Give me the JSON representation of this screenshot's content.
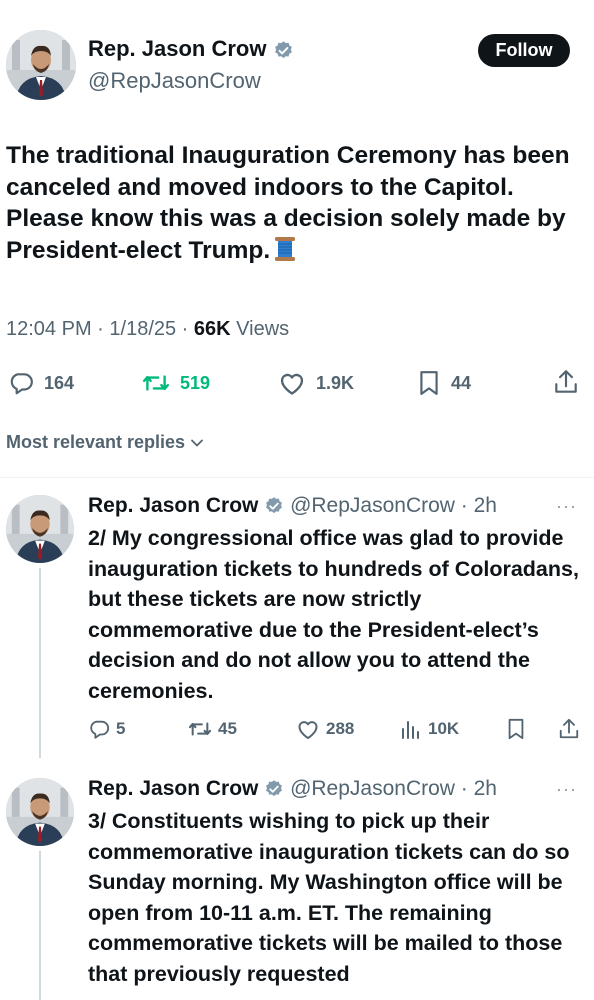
{
  "main_tweet": {
    "author_name": "Rep. Jason Crow",
    "handle": "@RepJasonCrow",
    "follow_label": "Follow",
    "text": "The traditional Inauguration Ceremony has been canceled and moved indoors to the Capitol. Please know this was a decision solely made by President-elect Trump.",
    "emoji_icon": "thread-spool-icon",
    "time": "12:04 PM",
    "date": "1/18/25",
    "views_count": "66K",
    "views_label": "Views",
    "stats": {
      "replies": "164",
      "retweets": "519",
      "likes": "1.9K",
      "bookmarks": "44"
    },
    "retweet_color": "#00ba7c"
  },
  "replies_sort_label": "Most relevant replies",
  "replies": [
    {
      "author_name": "Rep. Jason Crow",
      "handle": "@RepJasonCrow",
      "age": "2h",
      "text": "2/ My congressional office was glad to provide inauguration tickets to hundreds of Coloradans, but these tickets are now strictly commemorative due to the President-elect’s decision and do not allow you to attend the ceremonies.",
      "stats": {
        "replies": "5",
        "retweets": "45",
        "likes": "288",
        "views": "10K"
      }
    },
    {
      "author_name": "Rep. Jason Crow",
      "handle": "@RepJasonCrow",
      "age": "2h",
      "text": "3/ Constituents wishing to pick up their commemorative inauguration tickets can do so Sunday morning. My Washington office will be open from 10-11 a.m. ET. The remaining commemorative tickets will be mailed to those that previously requested"
    }
  ],
  "colors": {
    "verified_badge": "#829aab",
    "text_primary": "#0f1419",
    "text_muted": "#536471"
  }
}
